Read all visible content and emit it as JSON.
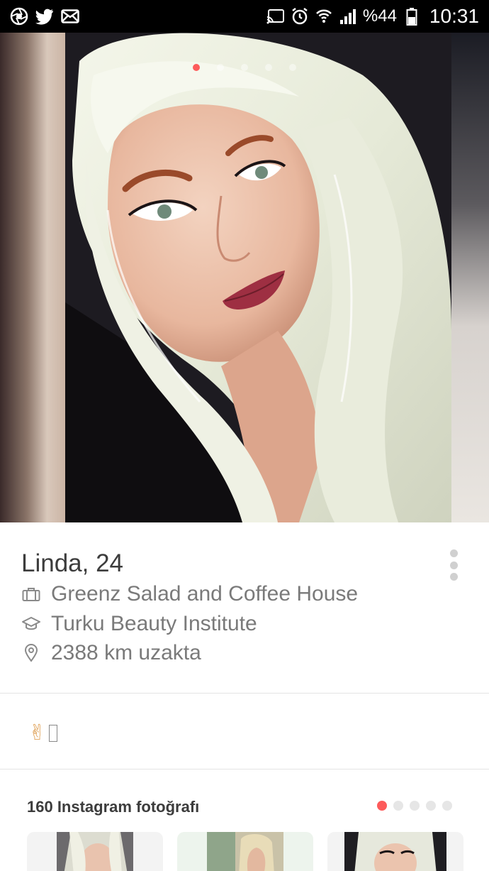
{
  "status_bar": {
    "left_icons": [
      "camera-shutter-icon",
      "twitter-icon",
      "mail-icon"
    ],
    "right_icons": [
      "cast-icon",
      "alarm-icon",
      "wifi-icon",
      "signal-icon",
      "battery-icon"
    ],
    "battery_text": "%44",
    "time": "10:31"
  },
  "photo": {
    "page_count": 5,
    "active_index": 0
  },
  "profile": {
    "name": "Linda",
    "separator": ", ",
    "age": "24",
    "job": "Greenz Salad and Coffee House",
    "school": "Turku Beauty Institute",
    "distance": "2388 km uzakta"
  },
  "bio": {
    "emoji": "✌"
  },
  "instagram": {
    "title": "160 Instagram fotoğrafı",
    "page_count": 5,
    "active_index": 0
  },
  "colors": {
    "accent": "#fd5b5b",
    "text_primary": "#3c3c3c",
    "text_secondary": "#7a7a7a"
  }
}
